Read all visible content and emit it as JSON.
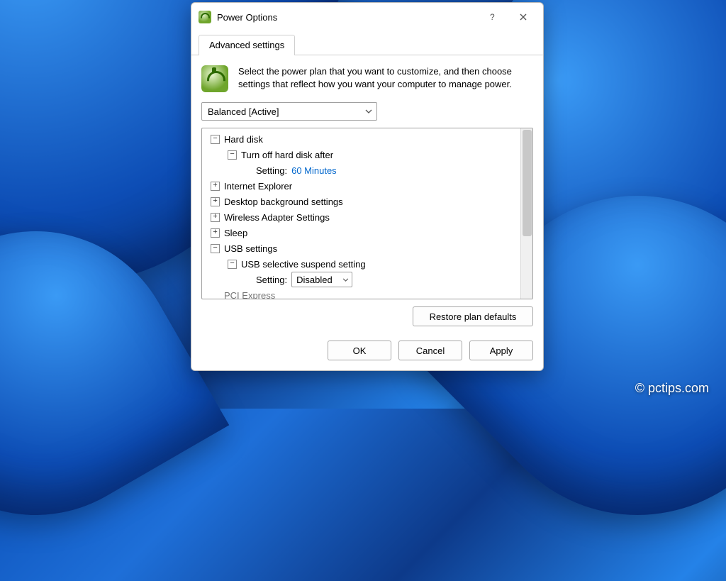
{
  "window": {
    "title": "Power Options"
  },
  "tabs": {
    "active": "Advanced settings"
  },
  "intro": "Select the power plan that you want to customize, and then choose settings that reflect how you want your computer to manage power.",
  "plan_selector": {
    "value": "Balanced [Active]"
  },
  "tree": {
    "hard_disk": {
      "label": "Hard disk",
      "turn_off": {
        "label": "Turn off hard disk after",
        "setting_label": "Setting:",
        "value": "60 Minutes"
      }
    },
    "ie": {
      "label": "Internet Explorer"
    },
    "desktop_bg": {
      "label": "Desktop background settings"
    },
    "wireless": {
      "label": "Wireless Adapter Settings"
    },
    "sleep": {
      "label": "Sleep"
    },
    "usb": {
      "label": "USB settings",
      "selective": {
        "label": "USB selective suspend setting",
        "setting_label": "Setting:",
        "value": "Disabled"
      }
    },
    "pci": {
      "label": "PCI Express"
    }
  },
  "buttons": {
    "restore": "Restore plan defaults",
    "ok": "OK",
    "cancel": "Cancel",
    "apply": "Apply"
  },
  "watermark": "© pctips.com"
}
